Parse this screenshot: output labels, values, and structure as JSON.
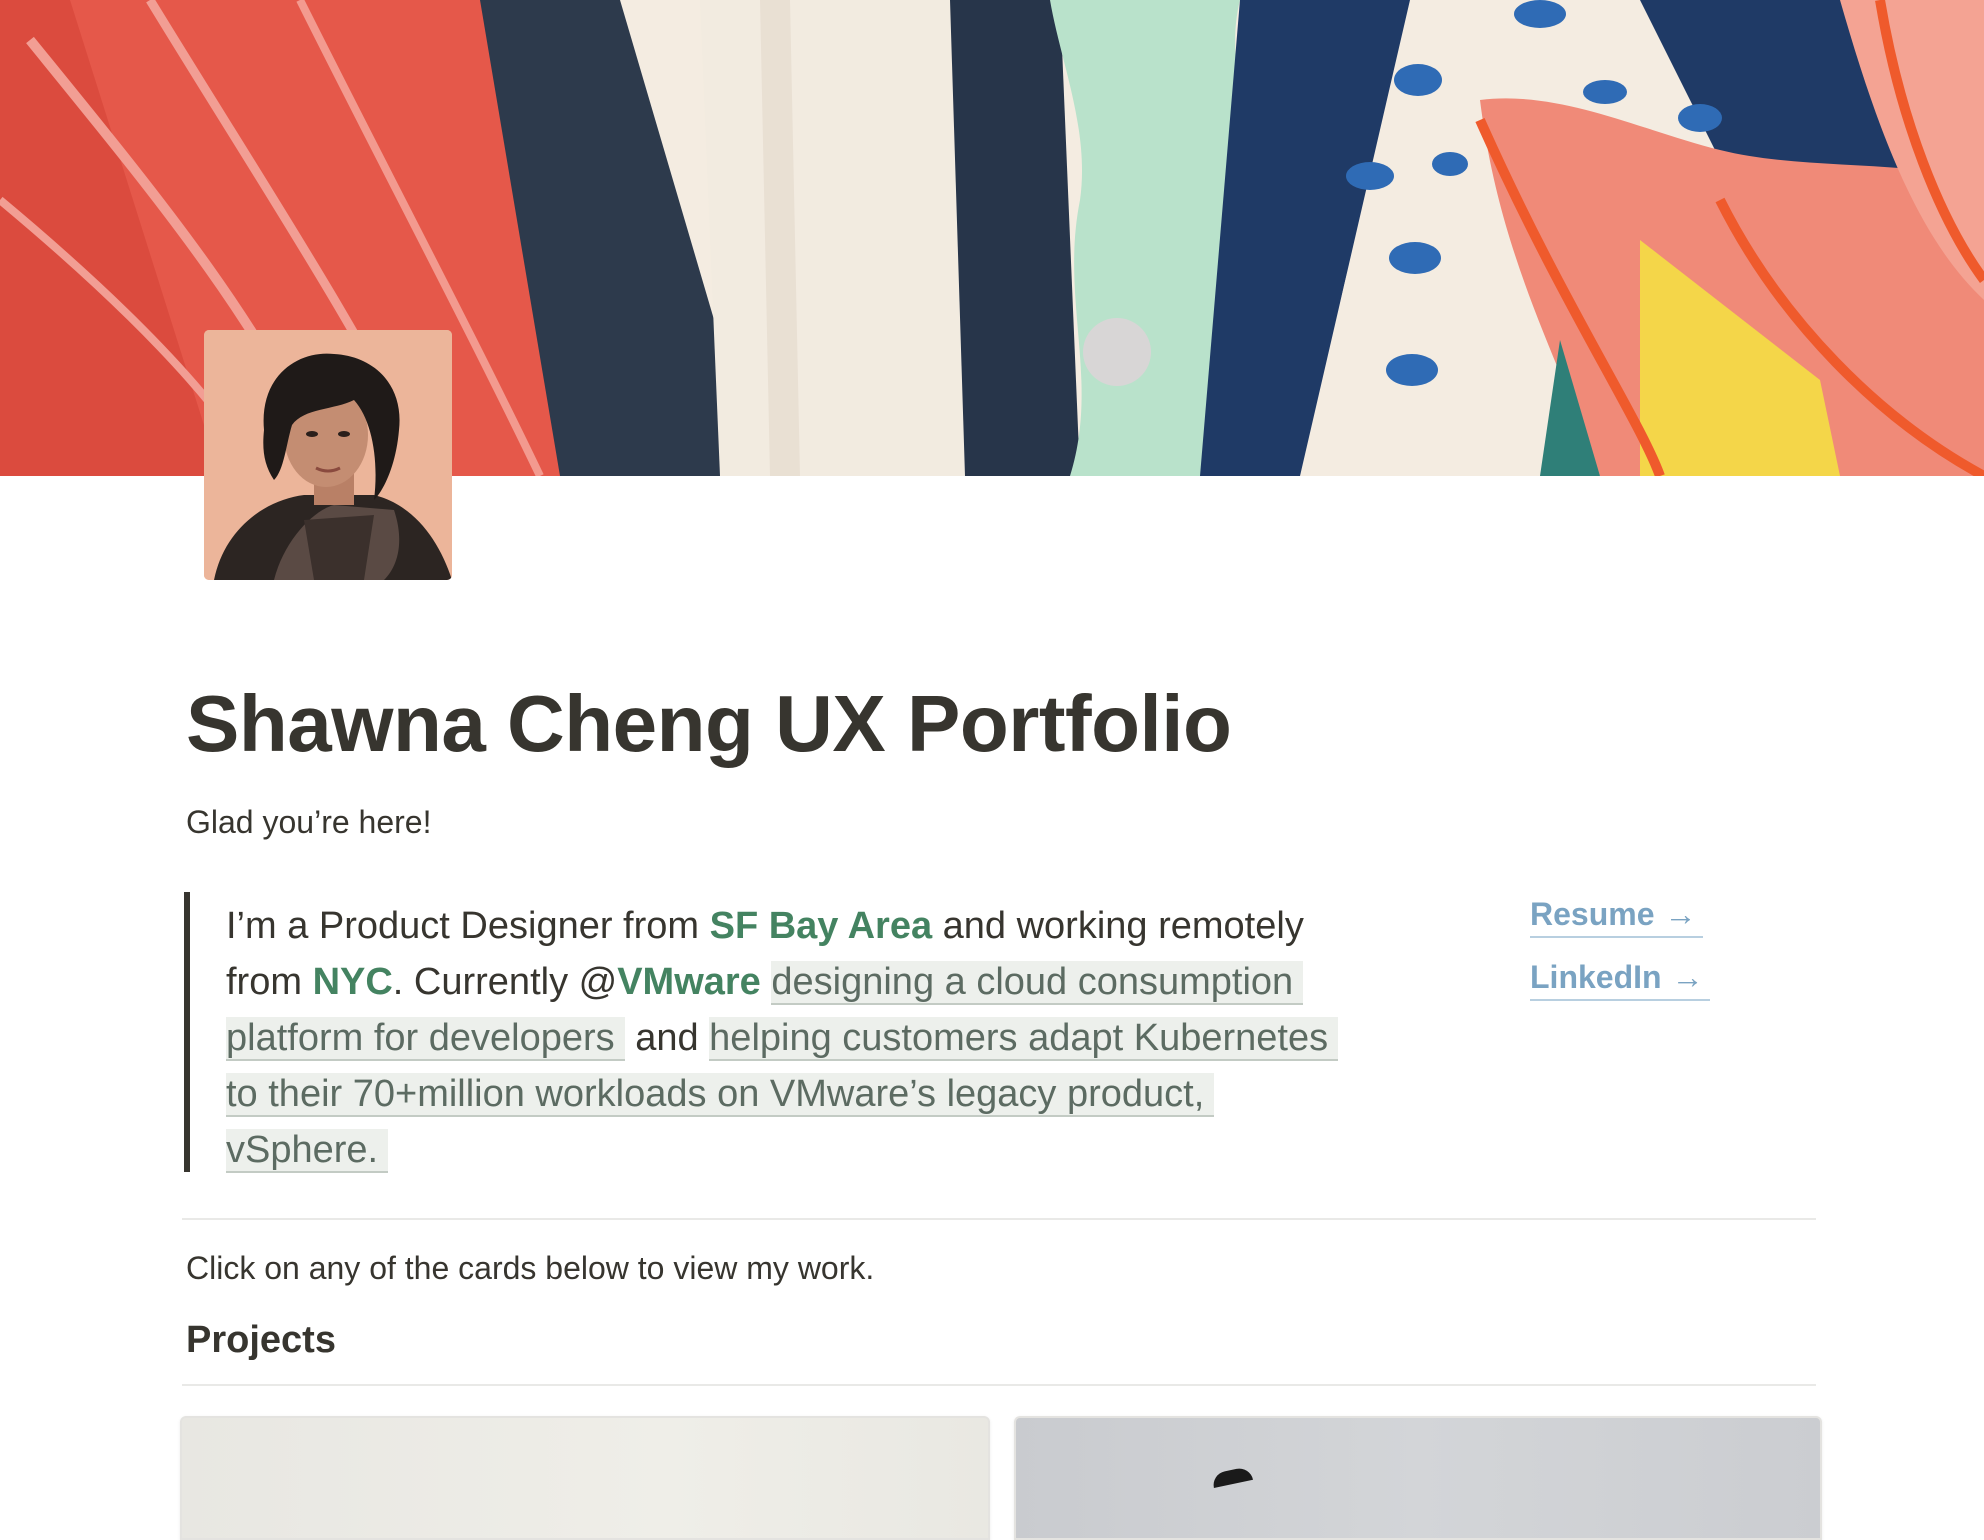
{
  "header": {
    "cover_image": "abstract-painted-mural",
    "avatar_image": "portrait-avatar"
  },
  "page": {
    "title": "Shawna Cheng UX Portfolio",
    "subtitle": "Glad you’re here!"
  },
  "intro": {
    "l1_a": "I’m a Product Designer from ",
    "l1_b": "SF Bay Area",
    "l1_c": " and working remotely",
    "l2_a": "from ",
    "l2_b": "NYC",
    "l2_c": ". Currently @",
    "l2_d": "VMware",
    "l2_e": " ",
    "l2_f": "designing a cloud consumption",
    "l3_a": "platform for developers",
    "l3_b": " and ",
    "l3_c": "helping customers adapt Kubernetes",
    "l4_a": "to their 70+million workloads on VMware’s legacy product,",
    "l5_a": "vSphere."
  },
  "links": {
    "resume": "Resume",
    "linkedin": "LinkedIn",
    "arrow": "→"
  },
  "content": {
    "instruction": "Click on any of the cards below to view my work.",
    "projects_heading": "Projects"
  },
  "colors": {
    "text": "#37352f",
    "green": "#448361",
    "link_blue": "#7aa3c2",
    "highlight_bg": "#edf0ec"
  }
}
